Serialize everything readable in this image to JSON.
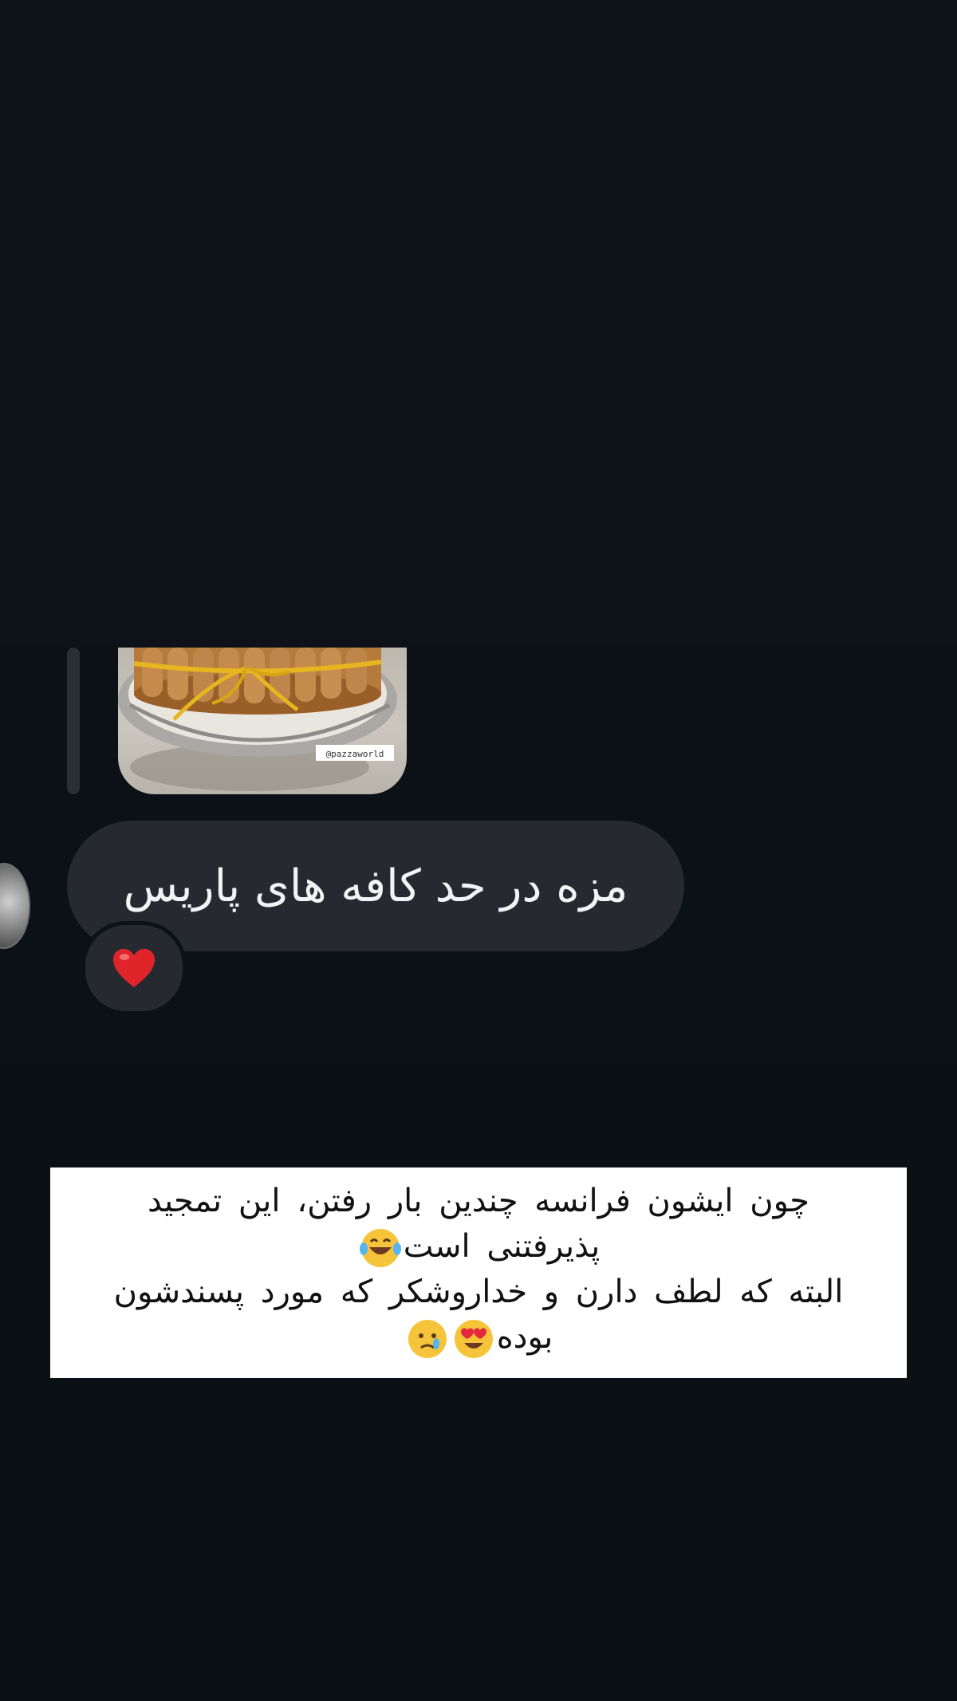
{
  "chat": {
    "photo": {
      "watermark": "@pazzaworld"
    },
    "message": {
      "text": "مزه در حد کافه های پاریس"
    },
    "reaction": {
      "icon": "red-heart-icon",
      "color": "#e0252a"
    }
  },
  "caption": {
    "line1": "چون ایشون فرانسه چندین بار رفتن، این تمجید",
    "line2": "پذیرفتنی است",
    "line3": "البته که لطف دارن و خداروشکر که مورد پسندشون",
    "line4": "بوده",
    "emojis": [
      "laughing-tears-emoji",
      "heart-eyes-emoji",
      "crying-face-emoji"
    ]
  },
  "colors": {
    "background": "#0b1015",
    "bubble": "#262a30",
    "caption_bg": "#ffffff"
  }
}
